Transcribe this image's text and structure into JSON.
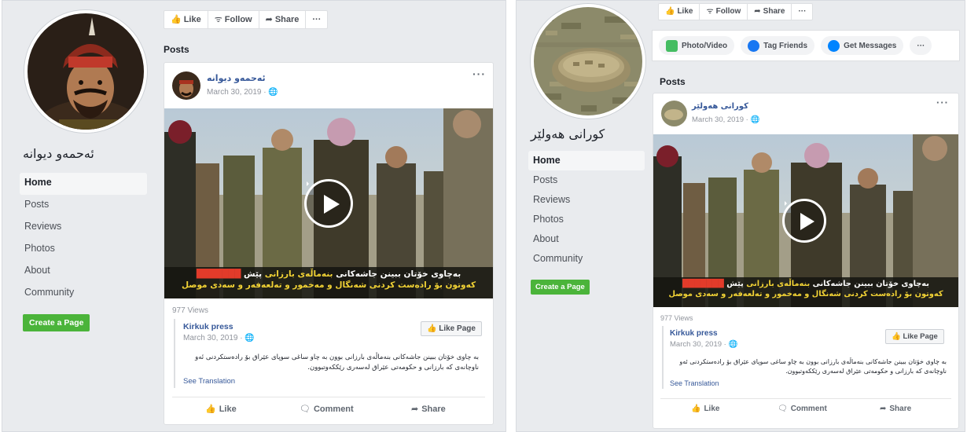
{
  "left": {
    "page_name": "ئەحمەو دیوانە",
    "nav": [
      "Home",
      "Posts",
      "Reviews",
      "Photos",
      "About",
      "Community"
    ],
    "create_page": "Create a Page",
    "actions": {
      "like": "Like",
      "follow": "Follow",
      "share": "Share",
      "more": "···"
    },
    "posts_title": "Posts",
    "post": {
      "author": "ئەحمەو دیوانە",
      "date": "March 30, 2019 · ",
      "menu": "···",
      "caption_line1_white": "بەچاوی خۆتان ببینن جاشەکانی ",
      "caption_line1_yellow": "بنەماڵەی بارزانی",
      "caption_line1_white2": " پێش ",
      "caption_line1_red": "",
      "caption_line2": "کەوتون بۆ رادەست کردنی شەنگال و مەخمور و تەلعەفەر و سەدی موصل",
      "views": "977 Views",
      "shared_name": "Kirkuk press",
      "shared_date": "March 30, 2019 · ",
      "like_page": "Like Page",
      "shared_text": "بە چاوی خۆتان ببینن جاشەکانی بنەماڵەی بارزانی بوون بە چاو ساغی سوپای عێراق بۆ رادەستکردنی ئەو ناوچانەی کە بارزانی و حکومەتی عێراق لەسەری رێککەوتبوون.",
      "see_translation": "See Translation",
      "footer": {
        "like": "Like",
        "comment": "Comment",
        "share": "Share"
      }
    }
  },
  "right": {
    "page_name": "کورانی هەولێر",
    "nav": [
      "Home",
      "Posts",
      "Reviews",
      "Photos",
      "About",
      "Community"
    ],
    "create_page": "Create a Page",
    "actions": {
      "like": "Like",
      "follow": "Follow",
      "share": "Share",
      "more": "···"
    },
    "cta": {
      "photo": "Photo/Video",
      "tag": "Tag Friends",
      "messages": "Get Messages",
      "more": "···"
    },
    "posts_title": "Posts",
    "post": {
      "author": "کورانی هەولێر",
      "date": "March 30, 2019 · ",
      "menu": "···",
      "caption_line1_white": "بەچاوی خۆتان ببینن جاشەکانی ",
      "caption_line1_yellow": "بنەماڵەی بارزانی",
      "caption_line1_white2": " پێش ",
      "caption_line1_red": "",
      "caption_line2": "کەوتون بۆ رادەست کردنی شەنگال و مەخمور و تەلعەفەر و سەدی موصل",
      "views": "977 Views",
      "shared_name": "Kirkuk press",
      "shared_date": "March 30, 2019 · ",
      "like_page": "Like Page",
      "shared_text": "بە چاوی خۆتان ببینن جاشەکانی بنەماڵەی بارزانی بوون بە چاو ساغی سوپای عێراق بۆ رادەستکردنی ئەو ناوچانەی کە بارزانی و حکومەتی عێراق لەسەری رێککەوتبوون.",
      "see_translation": "See Translation",
      "footer": {
        "like": "Like",
        "comment": "Comment",
        "share": "Share"
      }
    }
  },
  "colors": {
    "facebook_blue": "#365899",
    "create_green": "#4bb43a",
    "caption_yellow": "#f2d335",
    "caption_red": "#e23b2a"
  }
}
